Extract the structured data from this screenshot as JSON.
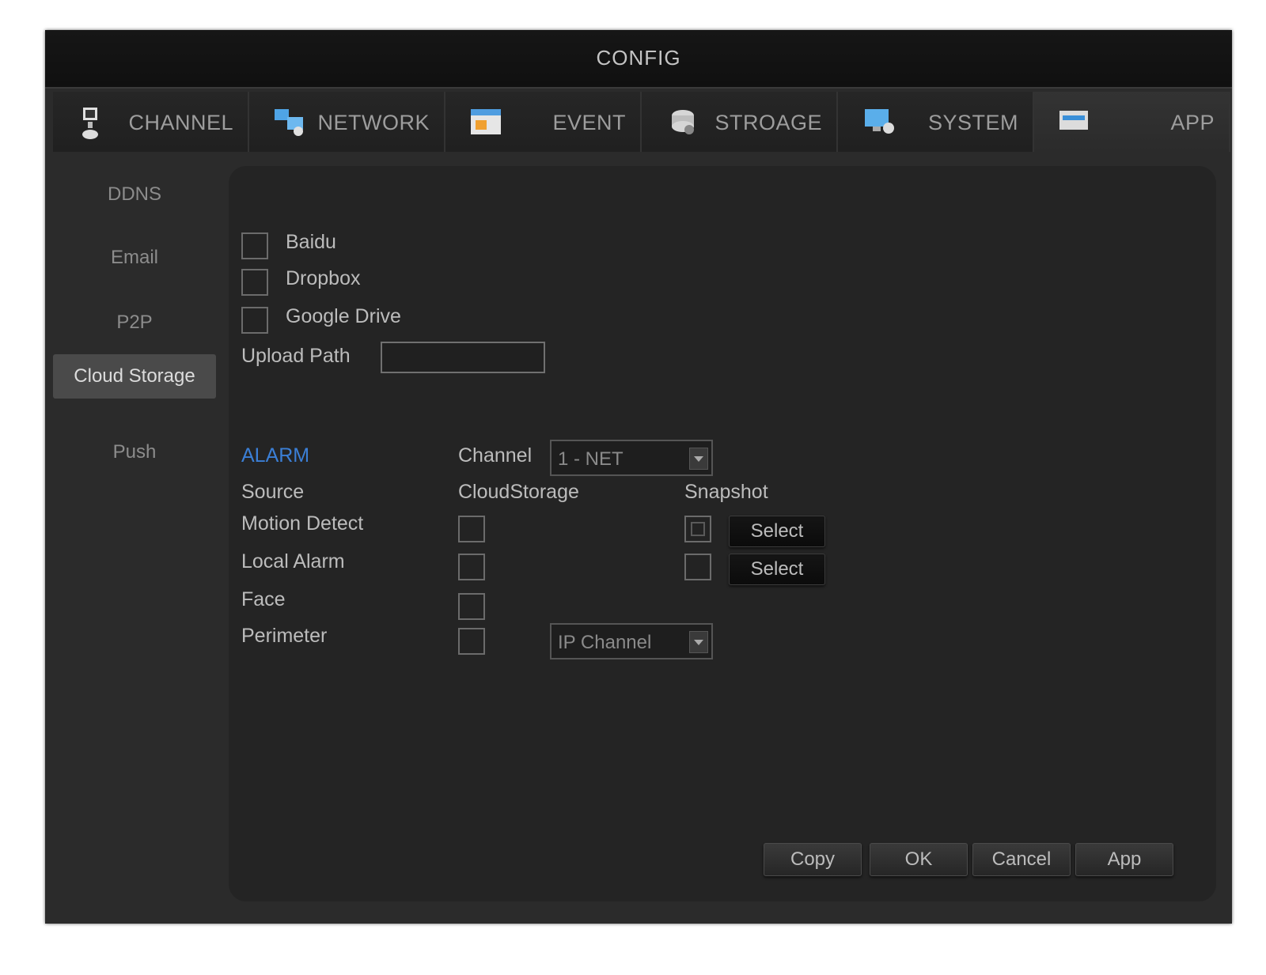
{
  "window": {
    "title": "CONFIG"
  },
  "tabs": [
    {
      "label": "CHANNEL",
      "icon": "camera-icon"
    },
    {
      "label": "NETWORK",
      "icon": "network-icon"
    },
    {
      "label": "EVENT",
      "icon": "event-icon"
    },
    {
      "label": "STROAGE",
      "icon": "storage-icon"
    },
    {
      "label": "SYSTEM",
      "icon": "system-icon"
    },
    {
      "label": "APP",
      "icon": "app-icon"
    }
  ],
  "sidebar": {
    "items": [
      {
        "label": "DDNS"
      },
      {
        "label": "Email"
      },
      {
        "label": "P2P"
      },
      {
        "label": "Cloud Storage"
      },
      {
        "label": "Push"
      }
    ],
    "active_index": 3
  },
  "cloud": {
    "providers": [
      {
        "label": "Baidu",
        "checked": false
      },
      {
        "label": "Dropbox",
        "checked": false
      },
      {
        "label": "Google Drive",
        "checked": false
      }
    ],
    "upload_path_label": "Upload Path",
    "upload_path_value": ""
  },
  "alarm": {
    "heading": "ALARM",
    "channel_label": "Channel",
    "channel_value": "1 - NET",
    "columns": {
      "source": "Source",
      "cloud": "CloudStorage",
      "snapshot": "Snapshot"
    },
    "rows": [
      {
        "source": "Motion Detect",
        "cloud_checked": false,
        "snapshot_checked": true,
        "select_label": "Select"
      },
      {
        "source": "Local Alarm",
        "cloud_checked": false,
        "snapshot_checked": false,
        "select_label": "Select"
      },
      {
        "source": "Face",
        "cloud_checked": false
      },
      {
        "source": "Perimeter",
        "cloud_checked": false,
        "dropdown_value": "IP Channel"
      }
    ]
  },
  "footer": {
    "copy_label": "Copy",
    "ok_label": "OK",
    "cancel_label": "Cancel",
    "apply_label": "App"
  },
  "colors": {
    "background": "#2b2b2b",
    "panel": "#242424",
    "accent": "#3b7fd6",
    "active_sidebar": "#4a4a4a"
  }
}
